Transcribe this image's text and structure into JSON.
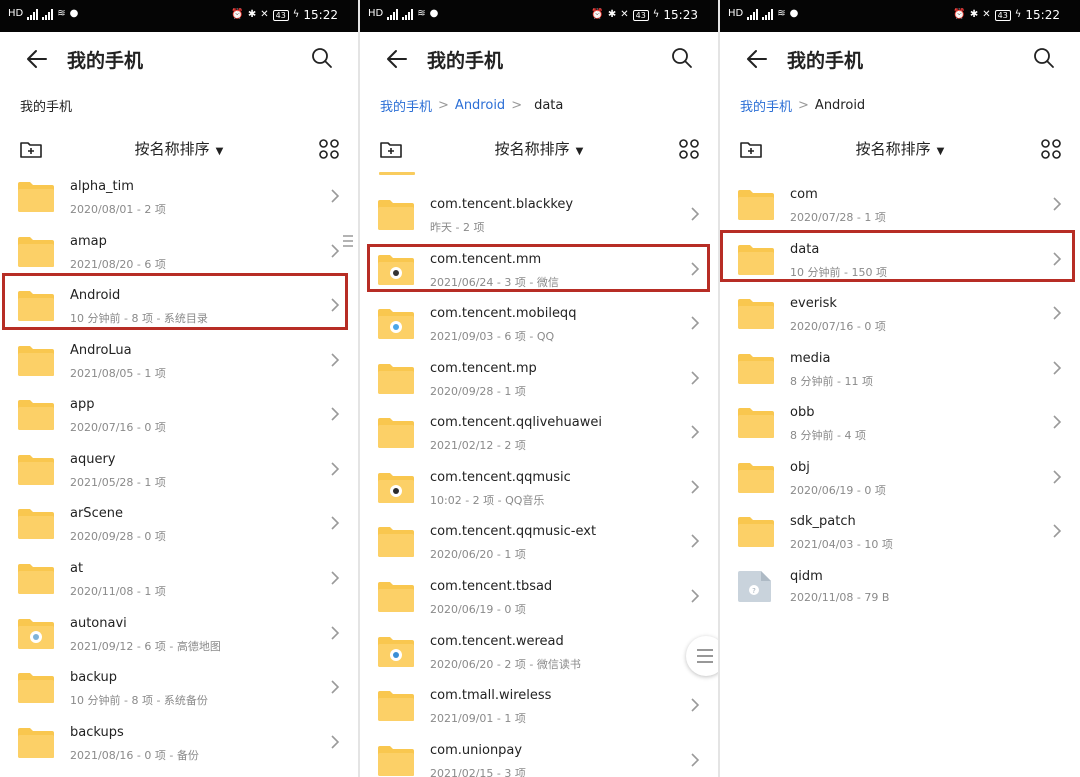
{
  "status": {
    "p1_time": "15:22",
    "p2_time": "15:23",
    "p3_time": "15:22",
    "battery": "43",
    "carrier_tag": "HD"
  },
  "colors": {
    "folder": "#f9c74f",
    "folder_dark": "#f2b730",
    "link": "#2c6fd6",
    "highlight": "#b72d25"
  },
  "icons": {
    "back": "arrow-left-icon",
    "search": "magnifier-icon",
    "new_folder": "folder-plus-icon",
    "view": "grid-icon",
    "chevron": "chevron-right-icon"
  },
  "panel1": {
    "title": "我的手机",
    "crumbs": [
      "我的手机"
    ],
    "sort_label": "按名称排序",
    "items": [
      {
        "name": "alpha_tim",
        "meta": "2020/08/01 - 2 项"
      },
      {
        "name": "amap",
        "meta": "2021/08/20 - 6 项"
      },
      {
        "name": "Android",
        "meta": "10 分钟前 - 8 项 - 系统目录"
      },
      {
        "name": "AndroLua",
        "meta": "2021/08/05 - 1 项"
      },
      {
        "name": "app",
        "meta": "2020/07/16 - 0 项"
      },
      {
        "name": "aquery",
        "meta": "2021/05/28 - 1 项"
      },
      {
        "name": "arScene",
        "meta": "2020/09/28 - 0 项"
      },
      {
        "name": "at",
        "meta": "2020/11/08 - 1 项"
      },
      {
        "name": "autonavi",
        "meta": "2021/09/12 - 6 项 - 高德地图"
      },
      {
        "name": "backup",
        "meta": "10 分钟前 - 8 项 - 系统备份"
      },
      {
        "name": "backups",
        "meta": "2021/08/16 - 0 项 - 备份"
      }
    ]
  },
  "panel2": {
    "title": "我的手机",
    "crumbs": [
      "我的手机",
      "Android",
      "data"
    ],
    "sort_label": "按名称排序",
    "items": [
      {
        "name": "com.tencent.blackkey",
        "meta": "昨天 - 2 项"
      },
      {
        "name": "com.tencent.mm",
        "meta": "2021/06/24 - 3 项 - 微信"
      },
      {
        "name": "com.tencent.mobileqq",
        "meta": "2021/09/03 - 6 项 - QQ"
      },
      {
        "name": "com.tencent.mp",
        "meta": "2020/09/28 - 1 项"
      },
      {
        "name": "com.tencent.qqlivehuawei",
        "meta": "2021/02/12 - 2 项"
      },
      {
        "name": "com.tencent.qqmusic",
        "meta": "10:02 - 2 项 - QQ音乐"
      },
      {
        "name": "com.tencent.qqmusic-ext",
        "meta": "2020/06/20 - 1 项"
      },
      {
        "name": "com.tencent.tbsad",
        "meta": "2020/06/19 - 0 项"
      },
      {
        "name": "com.tencent.weread",
        "meta": "2020/06/20 - 2 项 - 微信读书"
      },
      {
        "name": "com.tmall.wireless",
        "meta": "2021/09/01 - 1 项"
      },
      {
        "name": "com.unionpay",
        "meta": "2021/02/15 - 3 项"
      }
    ]
  },
  "panel3": {
    "title": "我的手机",
    "crumbs": [
      "我的手机",
      "Android"
    ],
    "sort_label": "按名称排序",
    "items": [
      {
        "name": "com",
        "meta": "2020/07/28 - 1 项"
      },
      {
        "name": "data",
        "meta": "10 分钟前 - 150 项"
      },
      {
        "name": "everisk",
        "meta": "2020/07/16 - 0 项"
      },
      {
        "name": "media",
        "meta": "8 分钟前 - 11 项"
      },
      {
        "name": "obb",
        "meta": "8 分钟前 - 4 项"
      },
      {
        "name": "obj",
        "meta": "2020/06/19 - 0 项"
      },
      {
        "name": "sdk_patch",
        "meta": "2021/04/03 - 10 项"
      },
      {
        "name": "qidm",
        "meta": "2020/11/08 - 79 B"
      }
    ]
  }
}
